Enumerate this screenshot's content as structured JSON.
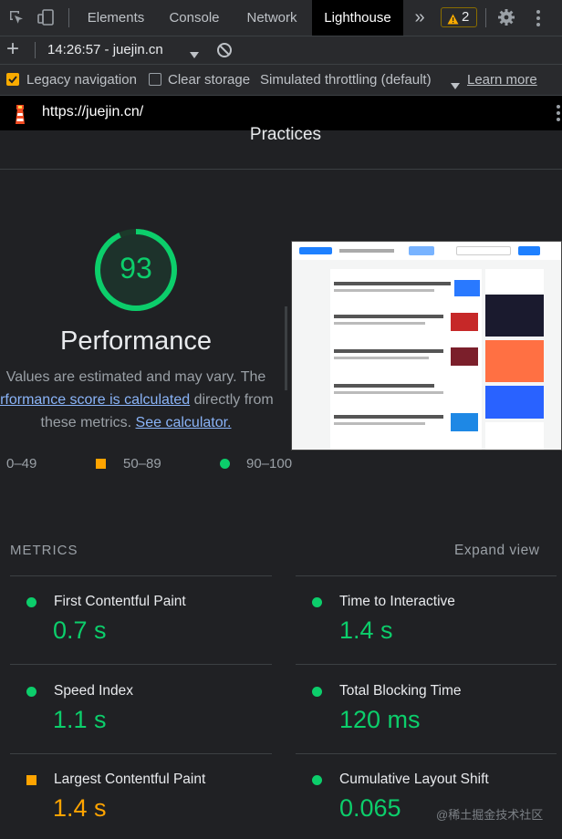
{
  "tabs": {
    "elements": "Elements",
    "console": "Console",
    "network": "Network",
    "lighthouse": "Lighthouse",
    "more": "»",
    "warnings_count": "2"
  },
  "toolbar": {
    "add": "+",
    "report_select": "14:26:57 - juejin.cn"
  },
  "options": {
    "legacy_navigation": "Legacy navigation",
    "clear_storage": "Clear storage",
    "throttling": "Simulated throttling (default)",
    "learn_more": "Learn more"
  },
  "url": "https://juejin.cn/",
  "section_heading": "Practices",
  "performance": {
    "score": "93",
    "title": "Performance",
    "desc_line1": "Values are estimated and may vary. The",
    "desc_link1": "performance score is calculated",
    "desc_line2_rest": " directly from",
    "desc_line3": "these metrics.",
    "desc_link2": "See calculator."
  },
  "legend": {
    "low": "0–49",
    "mid": "50–89",
    "high": "90–100"
  },
  "metrics": {
    "heading": "METRICS",
    "expand": "Expand view",
    "fcp_label": "First Contentful Paint",
    "fcp_value": "0.7 s",
    "tti_label": "Time to Interactive",
    "tti_value": "1.4 s",
    "si_label": "Speed Index",
    "si_value": "1.1 s",
    "tbt_label": "Total Blocking Time",
    "tbt_value": "120 ms",
    "lcp_label": "Largest Contentful Paint",
    "lcp_value": "1.4 s",
    "cls_label": "Cumulative Layout Shift",
    "cls_value": "0.065"
  },
  "watermark": "@稀土掘金技术社区",
  "colors": {
    "pass": "#0cce6b",
    "average": "#ffa400",
    "fail": "#ff4e42",
    "link": "#8ab4f8"
  }
}
